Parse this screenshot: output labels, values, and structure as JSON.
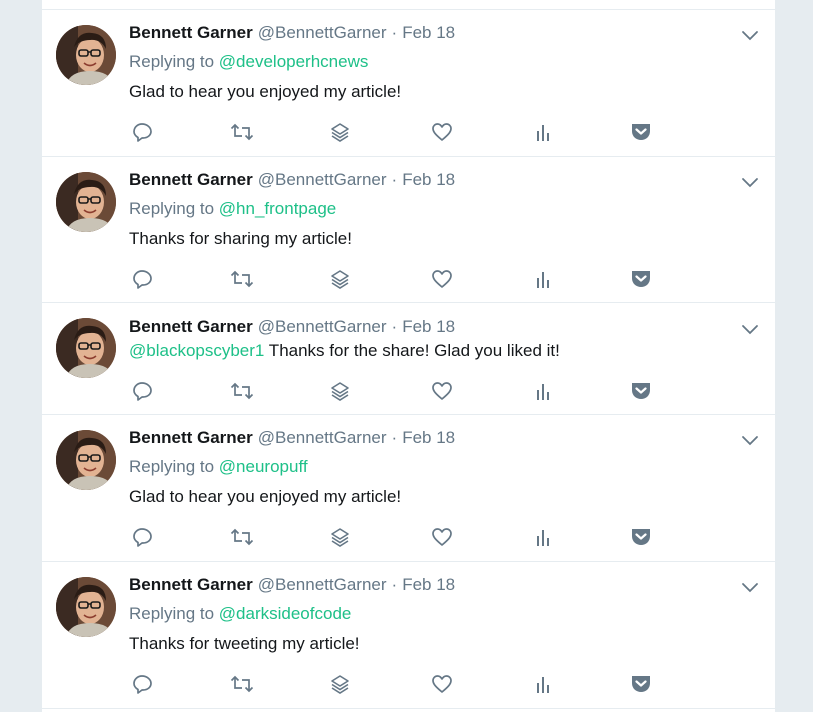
{
  "tweets": [
    {
      "name": "Bennett Garner",
      "handle": "@BennettGarner",
      "separator": "·",
      "date": "Feb 18",
      "replying_prefix": "Replying to",
      "replying_to": "@developerhcnews",
      "text": "Glad to hear you enjoyed my article!"
    },
    {
      "name": "Bennett Garner",
      "handle": "@BennettGarner",
      "separator": "·",
      "date": "Feb 18",
      "replying_prefix": "Replying to",
      "replying_to": "@hn_frontpage",
      "text": "Thanks for sharing my article!"
    },
    {
      "name": "Bennett Garner",
      "handle": "@BennettGarner",
      "separator": "·",
      "date": "Feb 18",
      "mention": "@blackopscyber1",
      "text": " Thanks for the share! Glad you liked it!"
    },
    {
      "name": "Bennett Garner",
      "handle": "@BennettGarner",
      "separator": "·",
      "date": "Feb 18",
      "replying_prefix": "Replying to",
      "replying_to": "@neuropuff",
      "text": "Glad to hear you enjoyed my article!"
    },
    {
      "name": "Bennett Garner",
      "handle": "@BennettGarner",
      "separator": "·",
      "date": "Feb 18",
      "replying_prefix": "Replying to",
      "replying_to": "@darksideofcode",
      "text": "Thanks for tweeting my article!"
    }
  ],
  "colors": {
    "link": "#1ec088",
    "muted": "#657786",
    "text": "#14171a",
    "background": "#e6ecf0",
    "icon": "#657786"
  },
  "icons": [
    "reply-icon",
    "retweet-icon",
    "layers-icon",
    "like-icon",
    "analytics-icon",
    "pocket-icon",
    "chevron-down-icon"
  ]
}
